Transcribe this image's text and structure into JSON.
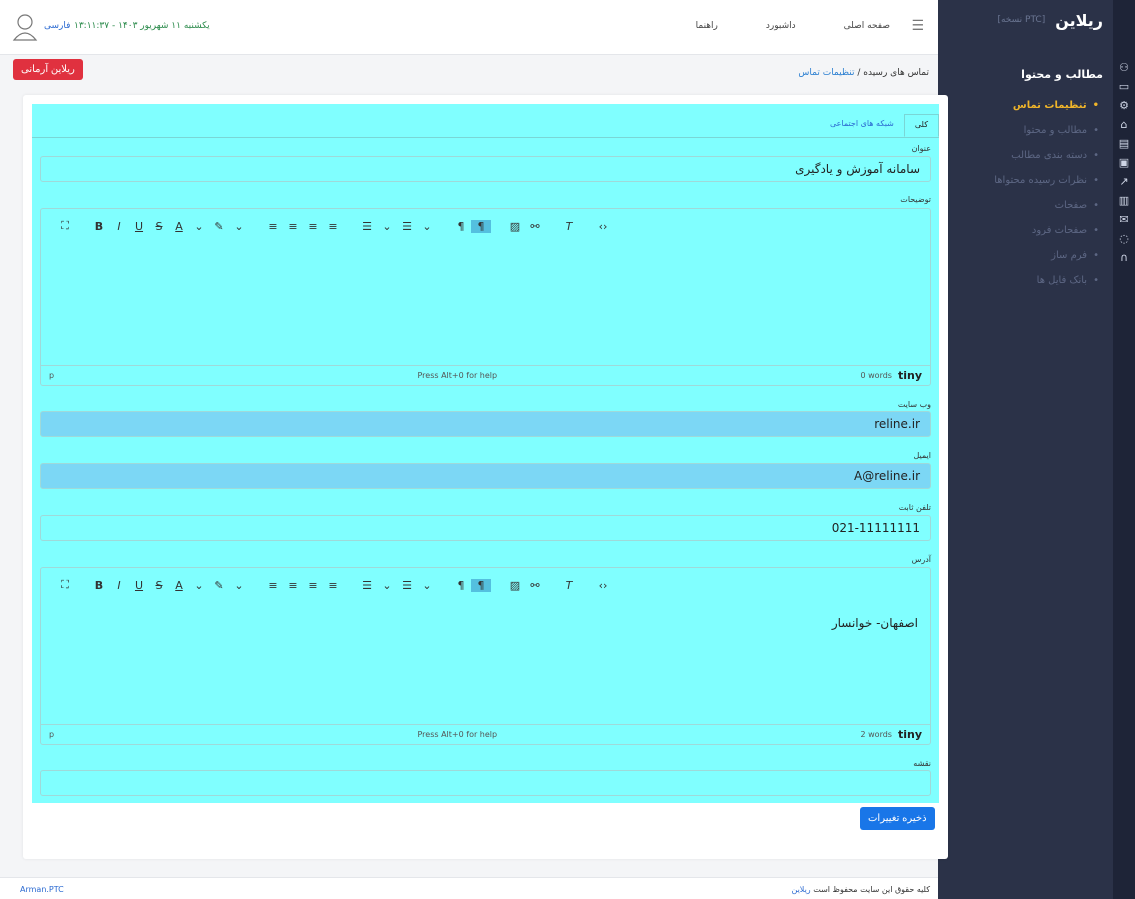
{
  "sidebar": {
    "logo": "ریلاین",
    "version": "[PTC نسخه]",
    "section_title": "مطالب و محتوا",
    "items": [
      {
        "label": "تنظیمات تماس"
      },
      {
        "label": "مطالب و محتوا"
      },
      {
        "label": "دسته بندی مطالب"
      },
      {
        "label": "نظرات رسیده محتواها"
      },
      {
        "label": "صفحات"
      },
      {
        "label": "صفحات فرود"
      },
      {
        "label": "فرم ساز"
      },
      {
        "label": "بانک فایل ها"
      }
    ]
  },
  "topbar": {
    "nav": [
      "صفحه اصلی",
      "داشبورد",
      "راهنما"
    ],
    "datetime": "یکشنبه ۱۱ شهریور ۱۴۰۳ - ۱۳:۱۱:۳۷",
    "lang": "فارسی"
  },
  "breadcrumb": {
    "parent": "تماس های رسیده",
    "separator": "/",
    "current": "تنظیمات تماس"
  },
  "arman_button": "ریلاین آرمانی",
  "tabs": [
    "کلی",
    "شبکه های اجتماعی"
  ],
  "form": {
    "title_label": "عنوان",
    "title_value": "سامانه آموزش و یادگیری",
    "desc_label": "توضیحات",
    "website_label": "وب سایت",
    "website_value": "reline.ir",
    "email_label": "ایمیل",
    "email_value": "A@reline.ir",
    "phone_label": "تلفن ثابت",
    "phone_value": "021-11111111",
    "address_label": "آدرس",
    "address_value": "اصفهان- خوانسار",
    "map_label": "نقشه"
  },
  "editor1": {
    "path": "p",
    "help": "Press Alt+0 for help",
    "words": "0 words",
    "brand": "tiny"
  },
  "editor2": {
    "path": "p",
    "help": "Press Alt+0 for help",
    "words": "2 words",
    "brand": "tiny"
  },
  "save_button": "ذخیره تغییرات",
  "footer": {
    "copyright": "کلیه حقوق این سایت محفوظ است",
    "link": "ریلاین",
    "left": "Arman.PTC"
  }
}
